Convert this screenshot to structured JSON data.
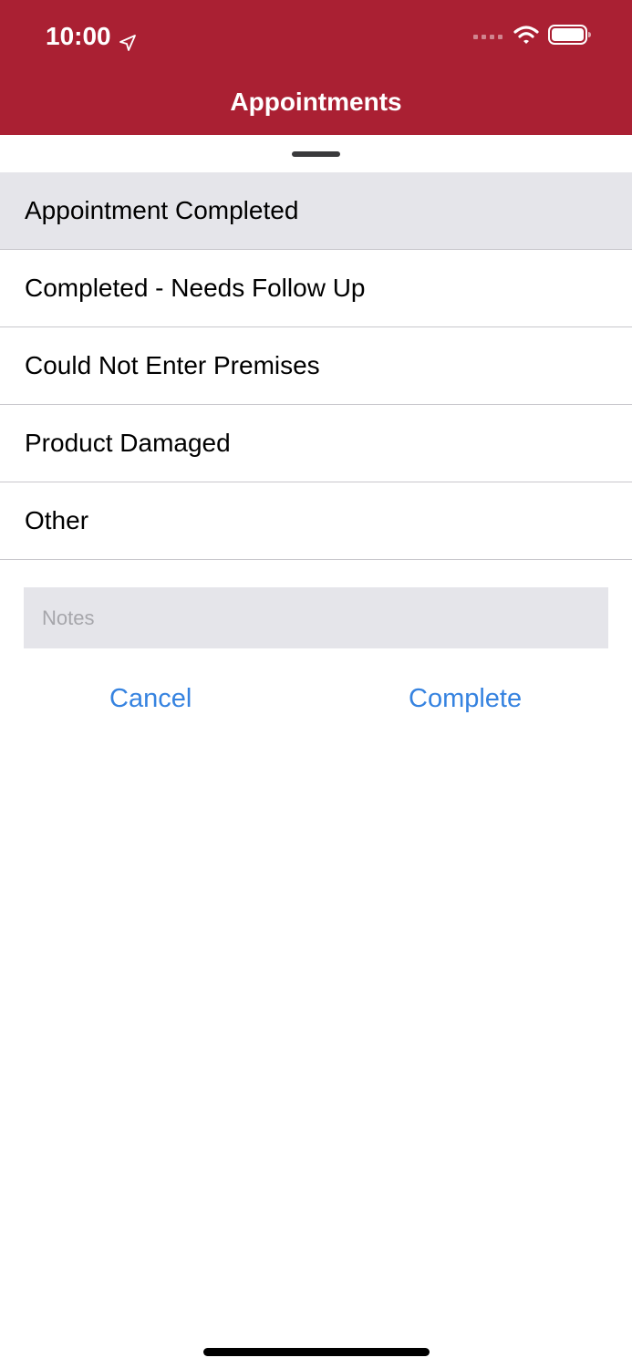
{
  "status_bar": {
    "time": "10:00",
    "icons": [
      "location-arrow-icon",
      "cellular-signal-icon",
      "wifi-icon",
      "battery-icon"
    ]
  },
  "header": {
    "title": "Appointments",
    "background_color": "#AA2033"
  },
  "options": [
    {
      "label": "Appointment Completed",
      "selected": true
    },
    {
      "label": "Completed - Needs Follow Up",
      "selected": false
    },
    {
      "label": "Could Not Enter Premises",
      "selected": false
    },
    {
      "label": "Product Damaged",
      "selected": false
    },
    {
      "label": "Other",
      "selected": false
    }
  ],
  "notes": {
    "placeholder": "Notes",
    "value": ""
  },
  "actions": {
    "cancel_label": "Cancel",
    "complete_label": "Complete",
    "accent_color": "#3683E0"
  }
}
